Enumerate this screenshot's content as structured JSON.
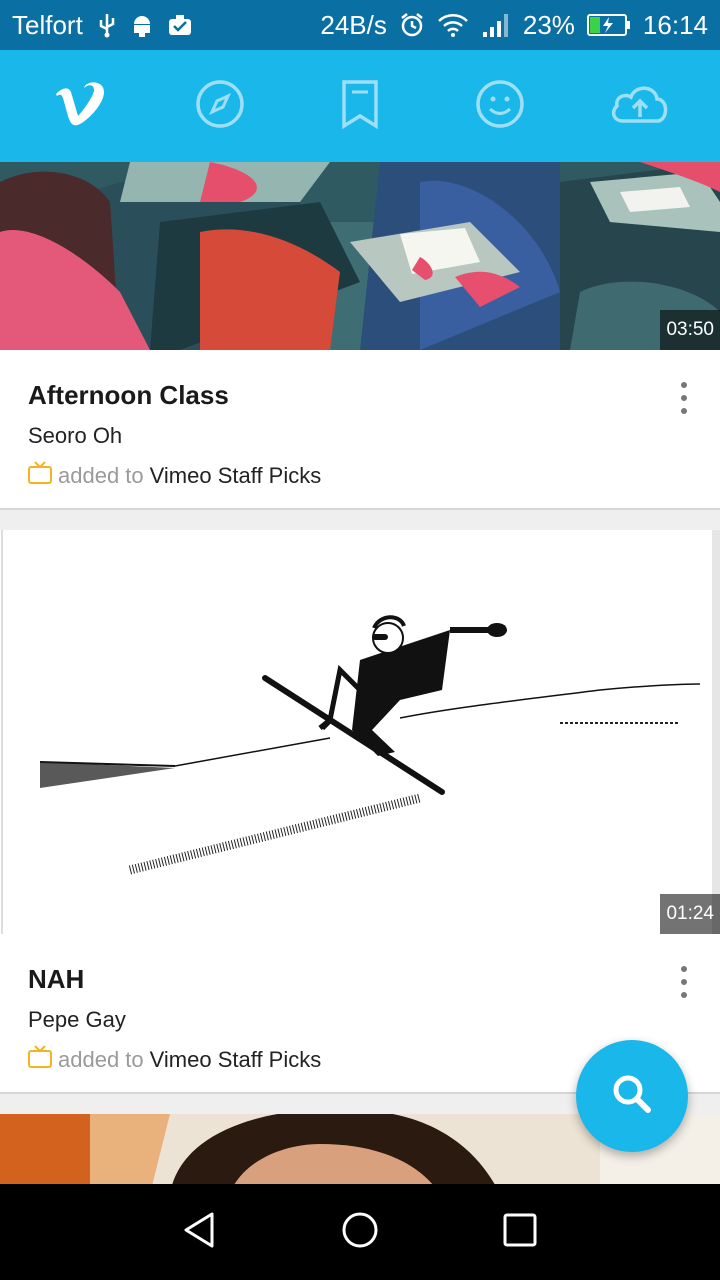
{
  "status_bar": {
    "carrier": "Telfort",
    "net_speed": "24B/s",
    "battery": "23%",
    "time": "16:14"
  },
  "nav": {
    "items": [
      "vimeo-logo-icon",
      "explore-compass-icon",
      "watch-later-bookmark-icon",
      "me-face-icon",
      "upload-cloud-icon"
    ],
    "accent": "#1ab7ea"
  },
  "feed": {
    "videos": [
      {
        "title": "Afternoon Class",
        "author": "Seoro Oh",
        "added_text": "added to",
        "channel": "Vimeo Staff Picks",
        "duration": "03:50"
      },
      {
        "title": "NAH",
        "author": "Pepe Gay",
        "added_text": "added to",
        "channel": "Vimeo Staff Picks",
        "duration": "01:24"
      }
    ]
  },
  "fab": {
    "icon": "search-icon"
  },
  "system_nav": [
    "back-icon",
    "home-icon",
    "recents-icon"
  ]
}
